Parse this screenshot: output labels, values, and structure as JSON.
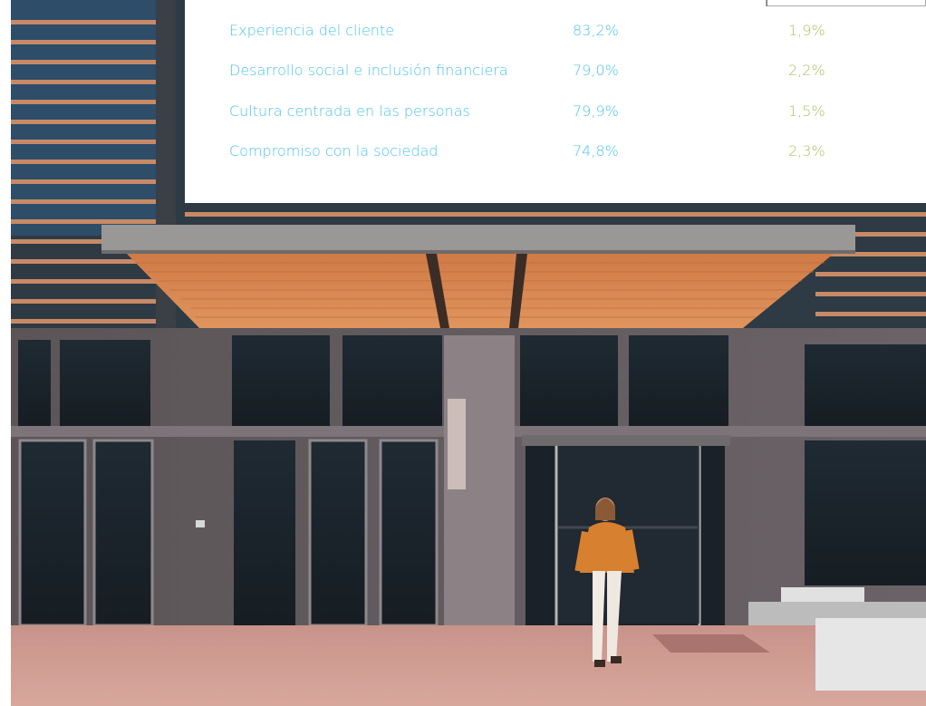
{
  "table": {
    "rows": [
      {
        "label": "Experiencia del cliente",
        "value": "83,2%",
        "change": "1,9%"
      },
      {
        "label": "Desarrollo social e inclusión financiera",
        "value": "79,0%",
        "change": "2,2%"
      },
      {
        "label": "Cultura centrada en las personas",
        "value": "79,9%",
        "change": "1,5%"
      },
      {
        "label": "Compromiso con la sociedad",
        "value": "74,8%",
        "change": "2,3%"
      }
    ]
  },
  "colors": {
    "label_blue": "#4cc3ea",
    "change_green": "#a4c564"
  },
  "photo": {
    "subject": "office-building-entrance-with-woman-walking"
  }
}
